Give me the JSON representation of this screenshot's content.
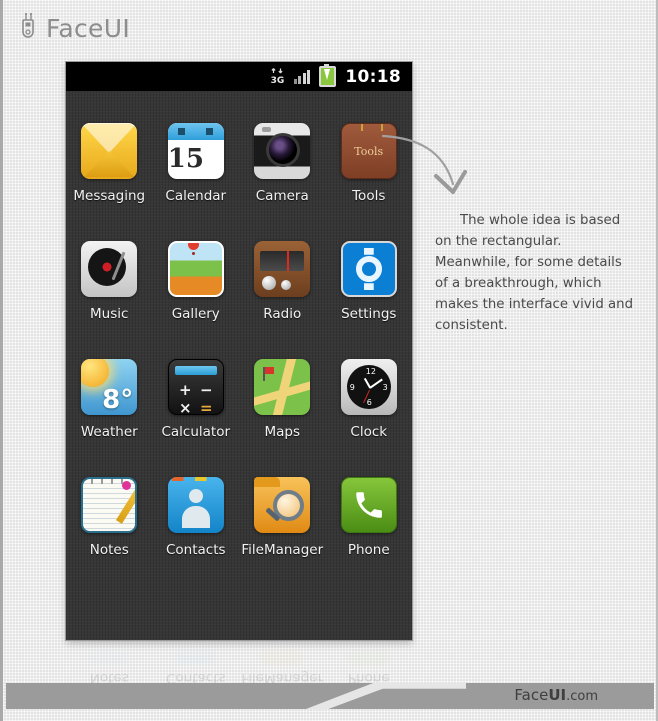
{
  "header": {
    "logo_text": "FaceUI",
    "logo_icon": "faceui-mark-icon"
  },
  "phone": {
    "statusbar": {
      "network_icon": "3g-icon",
      "network_label": "3G",
      "signal_icon": "signal-bars-icon",
      "battery_icon": "battery-charging-icon",
      "time": "10:18"
    },
    "apps": [
      {
        "label": "Messaging",
        "icon": "messaging-icon"
      },
      {
        "label": "Calendar",
        "icon": "calendar-icon",
        "day": "15"
      },
      {
        "label": "Camera",
        "icon": "camera-icon"
      },
      {
        "label": "Tools",
        "icon": "tools-icon",
        "badge": "Tools"
      },
      {
        "label": "Music",
        "icon": "music-icon"
      },
      {
        "label": "Gallery",
        "icon": "gallery-icon"
      },
      {
        "label": "Radio",
        "icon": "radio-icon"
      },
      {
        "label": "Settings",
        "icon": "settings-icon"
      },
      {
        "label": "Weather",
        "icon": "weather-icon",
        "temp": "8°"
      },
      {
        "label": "Calculator",
        "icon": "calculator-icon",
        "keys": [
          "+",
          "−",
          "×",
          "="
        ]
      },
      {
        "label": "Maps",
        "icon": "maps-icon"
      },
      {
        "label": "Clock",
        "icon": "clock-icon",
        "marks": [
          "12",
          "3",
          "6",
          "9"
        ]
      },
      {
        "label": "Notes",
        "icon": "notes-icon"
      },
      {
        "label": "Contacts",
        "icon": "contacts-icon"
      },
      {
        "label": "FileManager",
        "icon": "filemanager-icon"
      },
      {
        "label": "Phone",
        "icon": "phone-icon",
        "glyph": "📞"
      }
    ]
  },
  "annotation": {
    "arrow_icon": "curved-arrow-icon",
    "text": "The whole idea is based on the rectangular. Meanwhile, for some details of a breakthrough, which makes the interface vivid and consistent."
  },
  "footer": {
    "brand_a": "Face",
    "brand_b": "UI",
    "brand_c": ".com"
  },
  "colors": {
    "page_bg": "#e3e3e3",
    "phone_bg": "#363636",
    "statusbar_bg": "#000000",
    "label_text": "#f2f2f2",
    "note_text": "#4a4a4a",
    "footer_bar": "#9b9b9b",
    "battery_green": "#8bc63f",
    "logo_gray": "#8d8d8d"
  }
}
